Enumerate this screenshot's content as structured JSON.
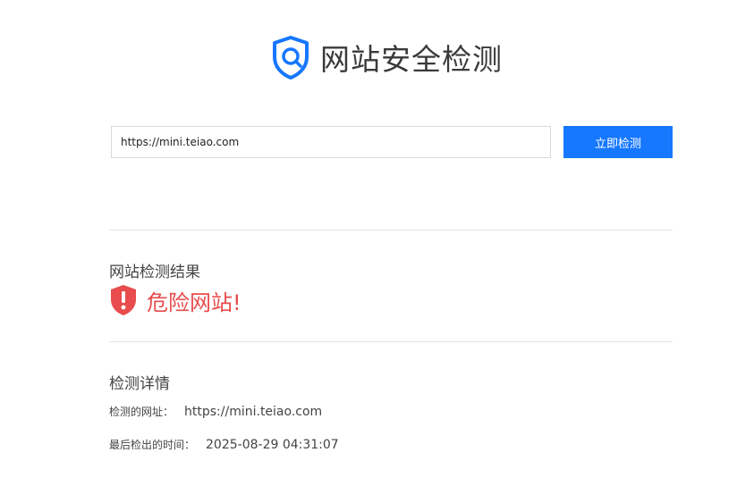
{
  "header": {
    "title": "网站安全检测",
    "logo_icon": "shield-search-icon",
    "accent_color": "#1677ff"
  },
  "search": {
    "value": "https://mini.teiao.com",
    "button_label": "立即检测"
  },
  "result": {
    "section_title": "网站检测结果",
    "status_text": "危险网站!",
    "status_icon": "danger-shield-icon",
    "status_color": "#e84c4c"
  },
  "details": {
    "section_title": "检测详情",
    "rows": [
      {
        "label": "检测的网址：",
        "value": "https://mini.teiao.com"
      },
      {
        "label": "最后检出的时间：",
        "value": "2025-08-29 04:31:07"
      }
    ]
  }
}
